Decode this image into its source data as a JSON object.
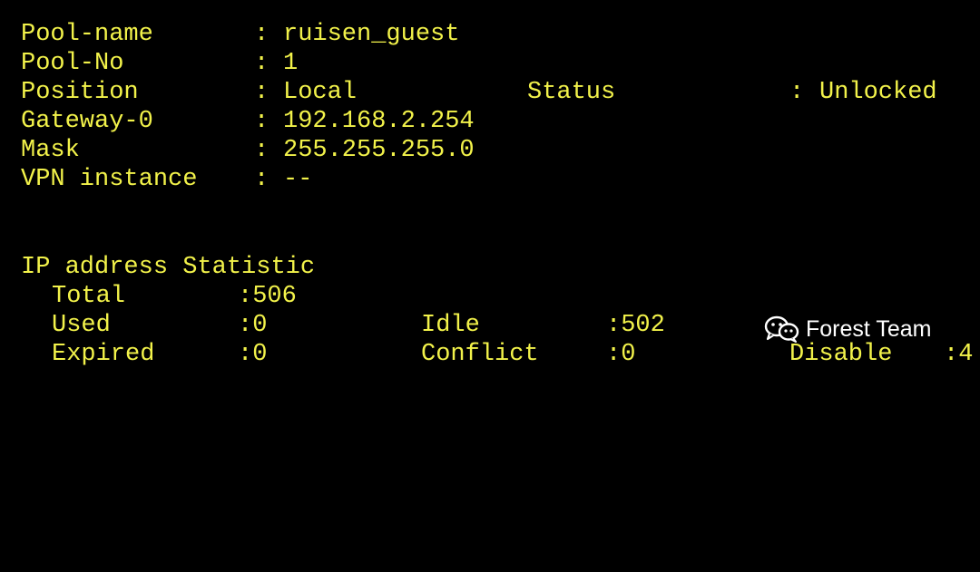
{
  "terminal": {
    "separator": "------------------------------------------------------------------------------------------------",
    "pool_fields": {
      "pool_name": {
        "label": "Pool-name",
        "sep": ":",
        "value": "ruisen_guest"
      },
      "pool_no": {
        "label": "Pool-No",
        "sep": ":",
        "value": "1"
      },
      "position": {
        "label": "Position",
        "sep": ":",
        "value": "Local"
      },
      "status": {
        "label": "Status",
        "sep": ":",
        "value": "Unlocked"
      },
      "gateway": {
        "label": "Gateway-0",
        "sep": ":",
        "value": "192.168.2.254"
      },
      "mask": {
        "label": "Mask",
        "sep": ":",
        "value": "255.255.255.0"
      },
      "vpn": {
        "label": "VPN instance",
        "sep": ":",
        "value": "--"
      }
    },
    "statistic": {
      "heading": "IP address Statistic",
      "total": {
        "label": "Total",
        "value": ":506"
      },
      "used": {
        "label": "Used",
        "value": ":0"
      },
      "idle": {
        "label": "Idle",
        "value": ":502"
      },
      "expired": {
        "label": "Expired",
        "value": ":0"
      },
      "conflict": {
        "label": "Conflict",
        "value": ":0"
      },
      "disable": {
        "label": "Disable",
        "value": ":4"
      }
    }
  },
  "watermark": {
    "text": "Forest Team",
    "icon": "wechat-icon"
  },
  "colors": {
    "background": "#000000",
    "terminal_text": "#f2f24a",
    "watermark_text": "#ffffff"
  }
}
